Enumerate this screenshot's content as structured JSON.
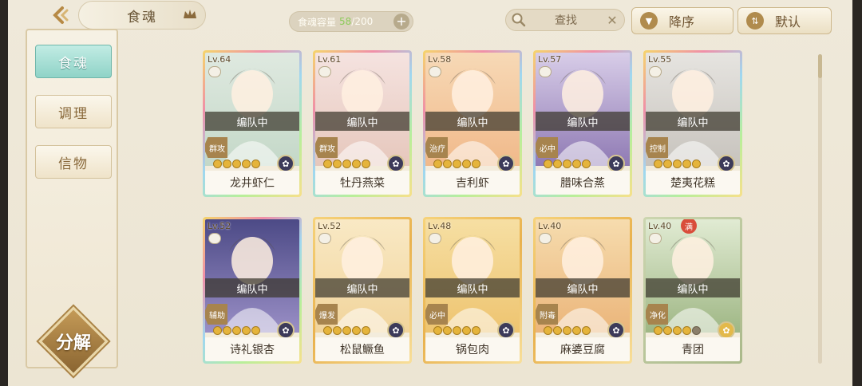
{
  "header": {
    "title": "食魂",
    "capacity_label": "食魂容量",
    "capacity_current": "58",
    "capacity_sep": "/",
    "capacity_max": "200",
    "capacity_plus": "+",
    "search_placeholder": "查找",
    "search_clear": "✕",
    "sort_order_label": "降序",
    "sort_mode_label": "默认"
  },
  "sidebar": {
    "items": [
      {
        "label": "食魂",
        "active": true
      },
      {
        "label": "调理",
        "active": false
      },
      {
        "label": "信物",
        "active": false
      }
    ],
    "decompose_label": "分解"
  },
  "colors": {
    "accent_teal": "#8fd3c7",
    "gold": "#e5b43b",
    "frame_brown": "#a7844e"
  },
  "cards": [
    {
      "level": "Lv.64",
      "name": "龙井虾仁",
      "status": "编队中",
      "role": "群攻",
      "stars": 5,
      "frame": "rainbow",
      "portrait_bg": [
        "#dfe9e0",
        "#c4d8c8"
      ],
      "element_color": "#3c3a5a",
      "full": false
    },
    {
      "level": "Lv.61",
      "name": "牡丹燕菜",
      "status": "编队中",
      "role": "群攻",
      "stars": 5,
      "frame": "rainbow",
      "portrait_bg": [
        "#f5e3e0",
        "#e6c7bc"
      ],
      "element_color": "#3c3a5a",
      "full": false
    },
    {
      "level": "Lv.58",
      "name": "吉利虾",
      "status": "编队中",
      "role": "治疗",
      "stars": 5,
      "frame": "rainbow",
      "portrait_bg": [
        "#f7d9b6",
        "#f0b98a"
      ],
      "element_color": "#3c3a5a",
      "full": false
    },
    {
      "level": "Lv.57",
      "name": "腊味合蒸",
      "status": "编队中",
      "role": "必中",
      "stars": 5,
      "frame": "rainbow",
      "portrait_bg": [
        "#d8cde8",
        "#8f7ab4"
      ],
      "element_color": "#3c3a5a",
      "full": false
    },
    {
      "level": "Lv.55",
      "name": "楚夷花糕",
      "status": "编队中",
      "role": "控制",
      "stars": 5,
      "frame": "rainbow",
      "portrait_bg": [
        "#e6e4e0",
        "#c7c3bd"
      ],
      "element_color": "#3c3a5a",
      "full": false
    },
    {
      "level": "Lv.52",
      "name": "诗礼银杏",
      "status": "编队中",
      "role": "辅助",
      "stars": 5,
      "frame": "rainbow",
      "portrait_bg": [
        "#4c4a86",
        "#9a8fc6"
      ],
      "element_color": "#3c3a5a",
      "full": false
    },
    {
      "level": "Lv.52",
      "name": "松鼠鳜鱼",
      "status": "编队中",
      "role": "爆发",
      "stars": 5,
      "frame": "gold",
      "portrait_bg": [
        "#f9e9c5",
        "#f1d49b"
      ],
      "element_color": "#3c3a5a",
      "full": false
    },
    {
      "level": "Lv.48",
      "name": "锅包肉",
      "status": "编队中",
      "role": "必中",
      "stars": 5,
      "frame": "gold",
      "portrait_bg": [
        "#f6dfa3",
        "#eec470"
      ],
      "element_color": "#3c3a5a",
      "full": false
    },
    {
      "level": "Lv.40",
      "name": "麻婆豆腐",
      "status": "编队中",
      "role": "附毒",
      "stars": 5,
      "frame": "gold",
      "portrait_bg": [
        "#f6dcae",
        "#ebb57a"
      ],
      "element_color": "#3c3a5a",
      "full": false
    },
    {
      "level": "Lv.40",
      "name": "青团",
      "status": "编队中",
      "role": "净化",
      "stars": 4,
      "frame": "green",
      "portrait_bg": [
        "#e1ebd3",
        "#9fb785"
      ],
      "element_color": "#e3b94a",
      "full": true,
      "full_label": "满"
    }
  ]
}
